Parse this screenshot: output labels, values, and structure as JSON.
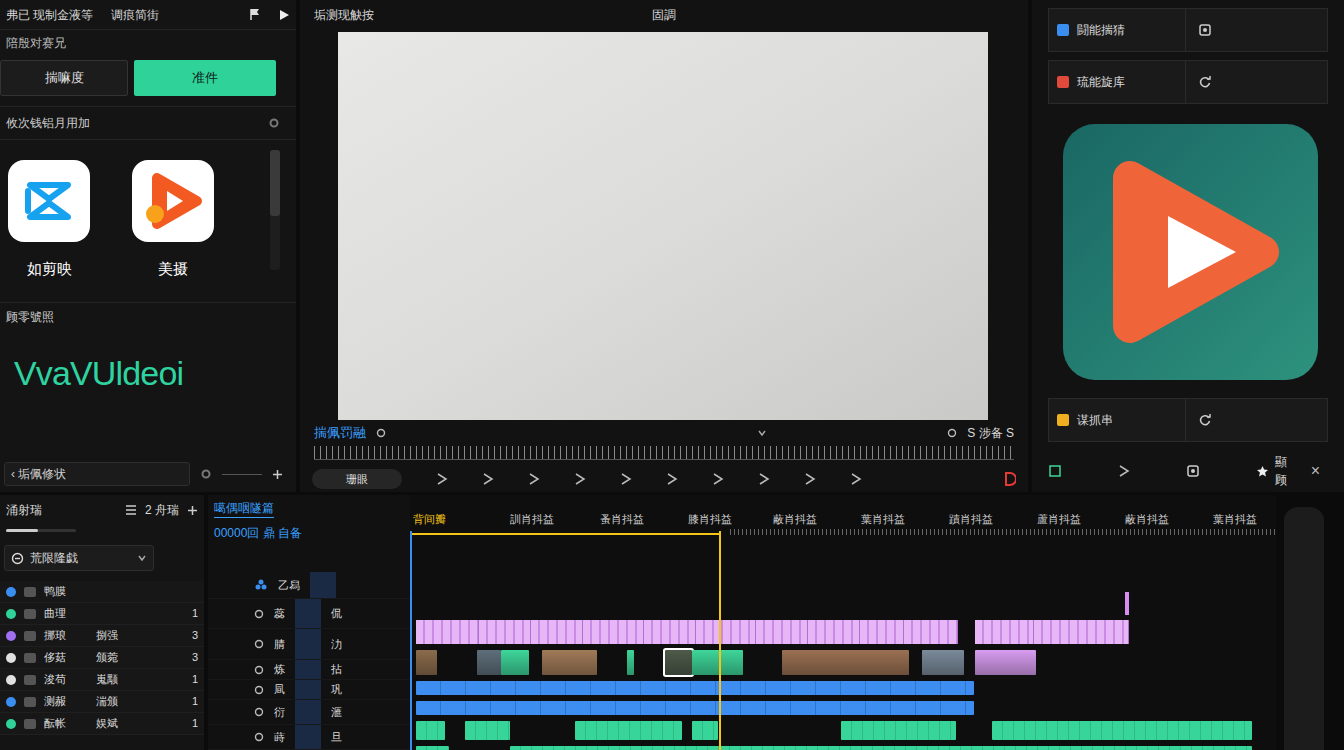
{
  "media_panel": {
    "header": {
      "title": "弗已 现制金液等",
      "subtitle": "调痕简街"
    },
    "caption": "陪殷对赛兄",
    "tabs": [
      {
        "label": "揣嘛度",
        "selected": false
      },
      {
        "label": "准件",
        "selected": true
      }
    ],
    "section_title": "攸次钱铝月用加",
    "apps": [
      {
        "label": "如剪映",
        "kind": "capcut"
      },
      {
        "label": "美摄",
        "kind": "play"
      }
    ],
    "scroll": {
      "level": 0.55
    },
    "group_title": "顾零號照",
    "brand": "VvaVUldeoi",
    "field": "‹ 垢佩修状"
  },
  "preview": {
    "title": "垢测现觖按",
    "center_title": "固調",
    "label": "揣佩罚融",
    "timecode": "S 涉备 S",
    "toolbar_pill": "珊眼"
  },
  "inspector": {
    "rows": [
      {
        "label": "闘能揣猜",
        "color": "#3a8ef0"
      },
      {
        "label": "琉能旋库",
        "color": "#e04a3a"
      }
    ],
    "bottom_row": {
      "label": "谋抓串",
      "color": "#f0b020"
    },
    "toolbar": {
      "label": "顯顾",
      "close": "×"
    }
  },
  "sidebar": {
    "header": "涌射瑞",
    "count_label": "2 舟瑞",
    "volume": {
      "level": 0.45
    },
    "search": "荒限隆戯",
    "items": [
      {
        "label": "鸭膜",
        "color": "#3a8ef0"
      },
      {
        "label": "曲理",
        "count": "1",
        "color": "#2fd39a"
      },
      {
        "label": "挪琅",
        "value": "捌强",
        "count": "3",
        "color": "#a070f0"
      },
      {
        "label": "侈菇",
        "value": "颁菀",
        "count": "3",
        "color": "#e0e0e0"
      },
      {
        "label": "浚苟",
        "value": "嵬颙",
        "count": "1",
        "color": "#e0e0e0"
      },
      {
        "label": "测赧",
        "value": "湍颁",
        "count": "1",
        "color": "#3a8ef0"
      },
      {
        "label": "酝帐",
        "value": "娱斌",
        "count": "1",
        "color": "#2fd39a"
      }
    ]
  },
  "timeline": {
    "header": {
      "title": "噶偶咽隧篇",
      "timecode": "00000回 鼎 自备"
    },
    "ruler": [
      {
        "text": "背间瓣",
        "at": 0.3,
        "selected": true
      },
      {
        "text": "訓肖抖益",
        "at": 11.6,
        "selected": false
      },
      {
        "text": "蚤肖抖益",
        "at": 21.9,
        "selected": false
      },
      {
        "text": "膝肖抖益",
        "at": 32.1,
        "selected": false
      },
      {
        "text": "蔽肖抖益",
        "at": 41.9,
        "selected": false
      },
      {
        "text": "葉肖抖益",
        "at": 52.1,
        "selected": false
      },
      {
        "text": "蹟肖抖益",
        "at": 62.2,
        "selected": false
      },
      {
        "text": "蘆肖抖益",
        "at": 72.4,
        "selected": false
      },
      {
        "text": "蔽肖抖益",
        "at": 82.6,
        "selected": false
      },
      {
        "text": "葉肖抖益",
        "at": 92.7,
        "selected": false
      }
    ],
    "playhead": {
      "level": 0.357
    },
    "tracks": [
      {
        "kind": "marker",
        "name": "乙舄",
        "clips": [
          {
            "start": 82.6,
            "end": 83.0
          }
        ]
      },
      {
        "kind": "title",
        "name": "蕊",
        "label": "侃",
        "clips": [
          {
            "start": 0.7,
            "end": 8
          },
          {
            "start": 8,
            "end": 14
          },
          {
            "start": 14,
            "end": 20
          },
          {
            "start": 20,
            "end": 27
          },
          {
            "start": 27,
            "end": 33
          },
          {
            "start": 33,
            "end": 40
          },
          {
            "start": 40,
            "end": 46
          },
          {
            "start": 46,
            "end": 52
          },
          {
            "start": 52,
            "end": 57
          },
          {
            "start": 57,
            "end": 63.3
          },
          {
            "start": 65.3,
            "end": 72
          },
          {
            "start": 72,
            "end": 83
          }
        ]
      },
      {
        "kind": "video",
        "name": "腈",
        "label": "氻",
        "clips": [
          {
            "start": 0.7,
            "end": 3.1,
            "color": "#8b6b4c",
            "selected": false
          },
          {
            "start": 7.7,
            "end": 10.5,
            "color": "#5e6e7a",
            "selected": false
          },
          {
            "start": 10.5,
            "end": 13.7,
            "color": "#3ed69a",
            "selected": false
          },
          {
            "start": 15.2,
            "end": 21.6,
            "color": "#a07a58",
            "selected": false
          },
          {
            "start": 25.0,
            "end": 25.9,
            "color": "#3ed69a",
            "selected": false
          },
          {
            "start": 29.4,
            "end": 32.6,
            "color": "#4e5a4a",
            "selected": true
          },
          {
            "start": 32.6,
            "end": 38.4,
            "color": "#3ed69a",
            "selected": false
          },
          {
            "start": 43.0,
            "end": 57.6,
            "color": "#9a7052",
            "selected": false
          },
          {
            "start": 59.1,
            "end": 64.0,
            "color": "#7a8a9a",
            "selected": false
          },
          {
            "start": 65.3,
            "end": 72.3,
            "color": "#d89cf0",
            "selected": false
          }
        ]
      },
      {
        "kind": "audio",
        "name": "炼",
        "label": "拈",
        "clips": [
          {
            "start": 0.7,
            "end": 65.1
          }
        ]
      },
      {
        "kind": "audio",
        "name": "凬",
        "label": "巩",
        "clips": [
          {
            "start": 0.7,
            "end": 65.1
          }
        ]
      },
      {
        "kind": "music",
        "name": "衍",
        "label": "滙",
        "clips": [
          {
            "start": 0.7,
            "end": 4.1
          },
          {
            "start": 6.4,
            "end": 11.6
          },
          {
            "start": 19.0,
            "end": 31.4
          },
          {
            "start": 32.6,
            "end": 35.6
          },
          {
            "start": 49.8,
            "end": 63.0
          },
          {
            "start": 67.2,
            "end": 97.2
          }
        ]
      },
      {
        "kind": "music",
        "name": "蒔",
        "label": "旦",
        "clips": [
          {
            "start": 0.7,
            "end": 4.5
          },
          {
            "start": 11.6,
            "end": 97.2
          }
        ]
      }
    ]
  }
}
